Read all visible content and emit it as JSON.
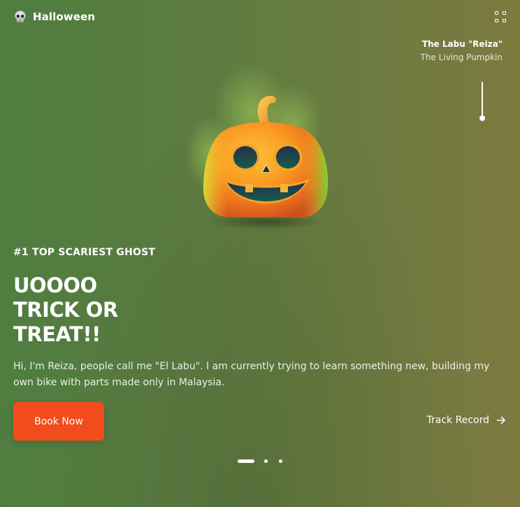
{
  "header": {
    "brand_name": "Halloween",
    "brand_icon": "skull-icon",
    "menu_icon": "grid-menu-icon"
  },
  "character": {
    "name": "The Labu \"Reiza\"",
    "description": "The Living Pumpkin",
    "image_icon": "pumpkin-illustration"
  },
  "hero": {
    "tagline": "#1 TOP SCARIEST GHOST",
    "headline_lines": [
      "UOOOO",
      "TRICK OR",
      "TREAT!!"
    ],
    "intro": "Hi, I'm Reiza, people call me \"El Labu\". I am currently trying to learn something new, building my own bike with parts made only in Malaysia."
  },
  "actions": {
    "book_label": "Book Now",
    "track_label": "Track Record",
    "track_icon": "arrow-right-icon"
  },
  "pager": {
    "total": 3,
    "active": 1
  },
  "colors": {
    "accent": "#f24b1c",
    "bg_left": "#4f7d40",
    "bg_right": "#7d7a40"
  }
}
